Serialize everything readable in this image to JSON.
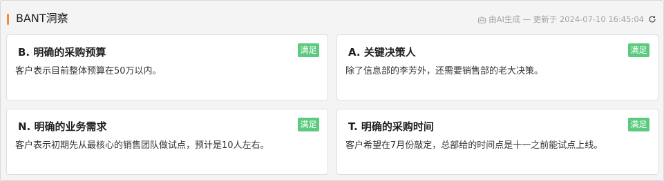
{
  "header": {
    "title": "BANT洞察",
    "meta": "由AI生成 — 更新于 2024-07-10 16:45:04",
    "accent_color": "#f08c3a",
    "ai_icon": "robot-icon",
    "refresh_icon": "refresh-icon"
  },
  "cards": [
    {
      "title": "B. 明确的采购预算",
      "badge": "满足",
      "desc": "客户表示目前整体预算在50万以内。"
    },
    {
      "title": "A. 关键决策人",
      "badge": "满足",
      "desc": "除了信息部的李芳外，还需要销售部的老大决策。"
    },
    {
      "title": "N. 明确的业务需求",
      "badge": "满足",
      "desc": "客户表示初期先从最核心的销售团队做试点，预计是10人左右。"
    },
    {
      "title": "T. 明确的采购时间",
      "badge": "满足",
      "desc": "客户希望在7月份敲定，总部给的时间点是十一之前能试点上线。"
    }
  ],
  "badge_color": "#5ccb7f"
}
